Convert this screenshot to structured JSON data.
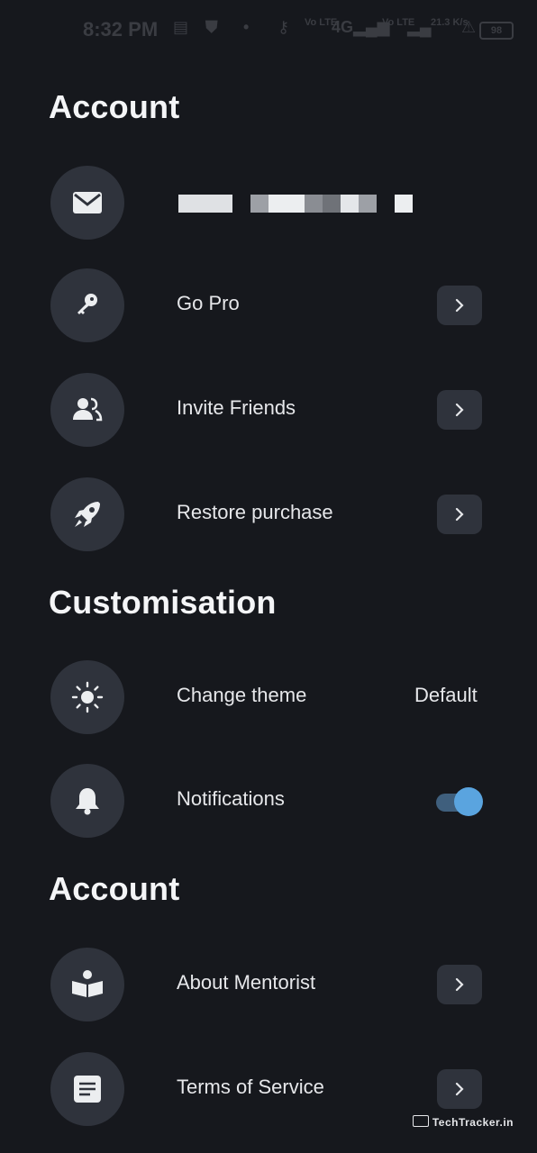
{
  "status_bar": {
    "time": "8:32 PM",
    "volte1": "Vo LTE",
    "network": "4G",
    "volte2": "Vo LTE",
    "speed": "21.3 K/s",
    "battery": "98"
  },
  "sections": [
    {
      "title": "Account",
      "items": [
        {
          "icon": "mail-icon",
          "label": "",
          "control": "none"
        },
        {
          "icon": "key-icon",
          "label": "Go Pro",
          "control": "chevron"
        },
        {
          "icon": "users-icon",
          "label": "Invite Friends",
          "control": "chevron"
        },
        {
          "icon": "rocket-icon",
          "label": "Restore purchase",
          "control": "chevron"
        }
      ]
    },
    {
      "title": "Customisation",
      "items": [
        {
          "icon": "sun-icon",
          "label": "Change theme",
          "control": "value",
          "value": "Default"
        },
        {
          "icon": "bell-icon",
          "label": "Notifications",
          "control": "toggle",
          "toggle_on": true
        }
      ]
    },
    {
      "title": "Account",
      "items": [
        {
          "icon": "book-reader-icon",
          "label": "About Mentorist",
          "control": "chevron"
        },
        {
          "icon": "document-icon",
          "label": "Terms of Service",
          "control": "chevron"
        }
      ]
    }
  ],
  "watermark": "TechTracker.in",
  "colors": {
    "background": "#16181d",
    "icon_circle": "#2f333c",
    "toggle_knob": "#5aa4df",
    "toggle_track": "#3f5f7d"
  }
}
